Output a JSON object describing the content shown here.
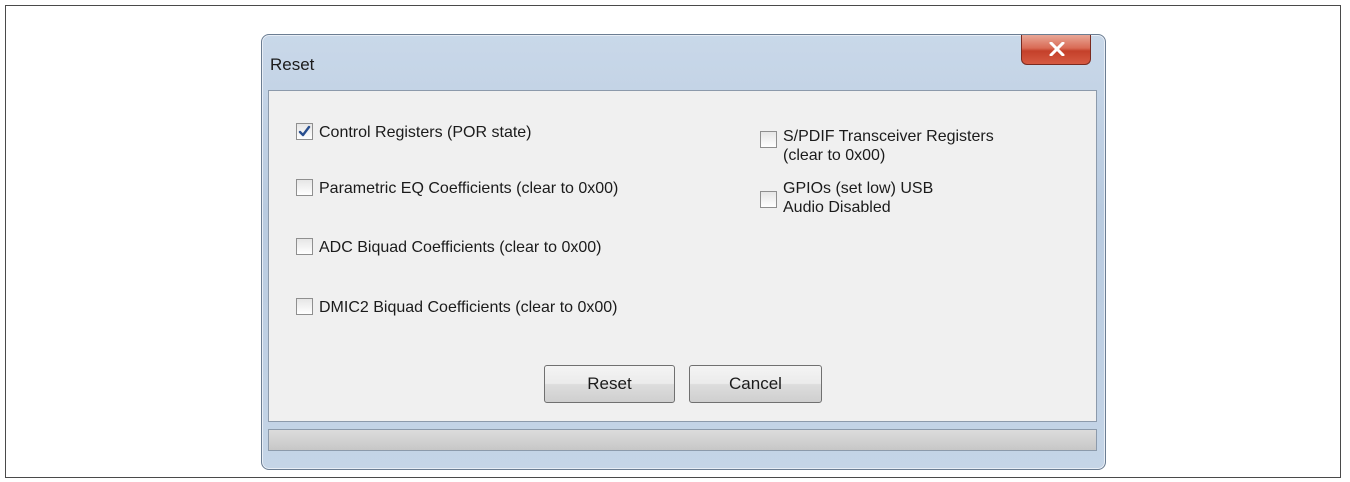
{
  "dialog": {
    "title": "Reset",
    "checkboxes": [
      {
        "label": "Control Registers (POR state)",
        "checked": true
      },
      {
        "label": "Parametric EQ Coefficients (clear to 0x00)",
        "checked": false
      },
      {
        "label": "ADC Biquad Coefficients (clear to 0x00)",
        "checked": false
      },
      {
        "label": "DMIC2 Biquad Coefficients (clear to 0x00)",
        "checked": false
      },
      {
        "label_line1": "S/PDIF Transceiver Registers",
        "label_line2": "(clear to 0x00)",
        "checked": false
      },
      {
        "label_line1": "GPIOs (set low) USB",
        "label_line2": "Audio Disabled",
        "checked": false
      }
    ],
    "buttons": {
      "reset_label": "Reset",
      "cancel_label": "Cancel"
    }
  },
  "icons": {
    "close": "close-icon",
    "check": "checkmark-icon"
  },
  "colors": {
    "close_button": "#c4402a",
    "titlebar": "#c9d8e9",
    "client_background": "#f0f0f0",
    "checkmark": "#2a4f8f"
  }
}
